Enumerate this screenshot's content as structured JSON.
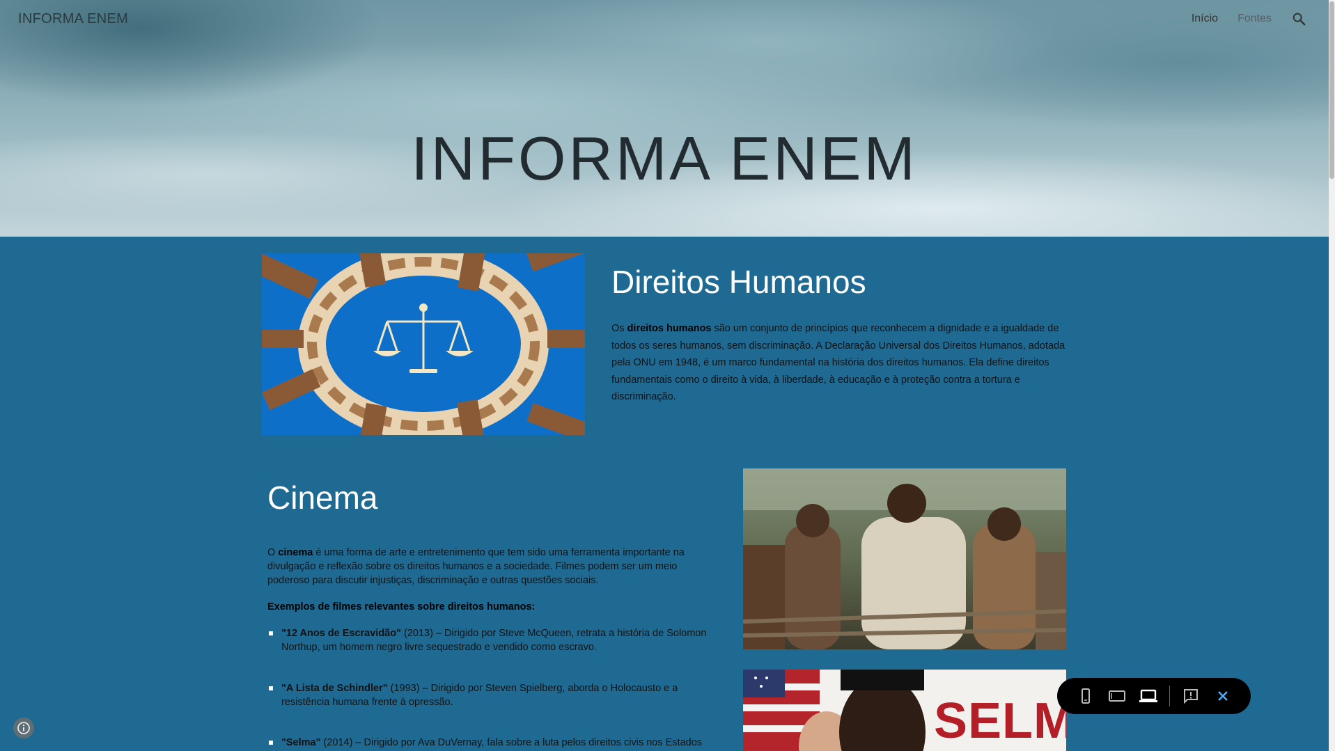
{
  "header": {
    "site_title": "INFORMA ENEM",
    "nav": [
      {
        "label": "Início"
      },
      {
        "label": "Fontes"
      }
    ],
    "search_icon": "search-icon",
    "hero_heading": "INFORMA ENEM"
  },
  "rights": {
    "image_icon": "justice-scale-hands-image",
    "heading": "Direitos Humanos",
    "text_intro": "Os ",
    "text_bold": "direitos humanos",
    "text_rest": " são um conjunto de princípios que reconhecem a dignidade e a igualdade de todos os seres humanos, sem discriminação. A Declaração Universal dos Direitos Humanos, adotada pela ONU em 1948, é um marco fundamental na história dos direitos humanos. Ela define direitos fundamentais como o direito à vida, à liberdade, à educação e à proteção contra a tortura e discriminação."
  },
  "cinema": {
    "heading": "Cinema",
    "text_intro": "O ",
    "text_bold": "cinema",
    "text_rest": " é uma forma de arte e entretenimento que tem sido uma ferramenta importante na divulgação e reflexão sobre os direitos humanos e a sociedade. Filmes podem ser um meio poderoso para discutir injustiças, discriminação e outras questões sociais.",
    "examples_heading": "Exemplos de filmes relevantes sobre direitos humanos:",
    "films": [
      {
        "title": "\"12 Anos de Escravidão\"",
        "desc": " (2013) – Dirigido por Steve McQueen, retrata a história de Solomon Northup, um homem negro livre sequestrado e vendido como escravo."
      },
      {
        "title": "\"A Lista de Schindler\"",
        "desc": " (1993) – Dirigido por Steven Spielberg, aborda o Holocausto e a resistência humana frente à opressão."
      },
      {
        "title": "\"Selma\"",
        "desc": " (2014) – Dirigido por Ava DuVernay, fala sobre a luta pelos direitos civis nos Estados"
      }
    ],
    "poster_text": "SELMA"
  },
  "toolbar": {
    "buttons": [
      "phone-icon",
      "tablet-icon",
      "laptop-icon",
      "report-icon",
      "close-icon"
    ]
  }
}
